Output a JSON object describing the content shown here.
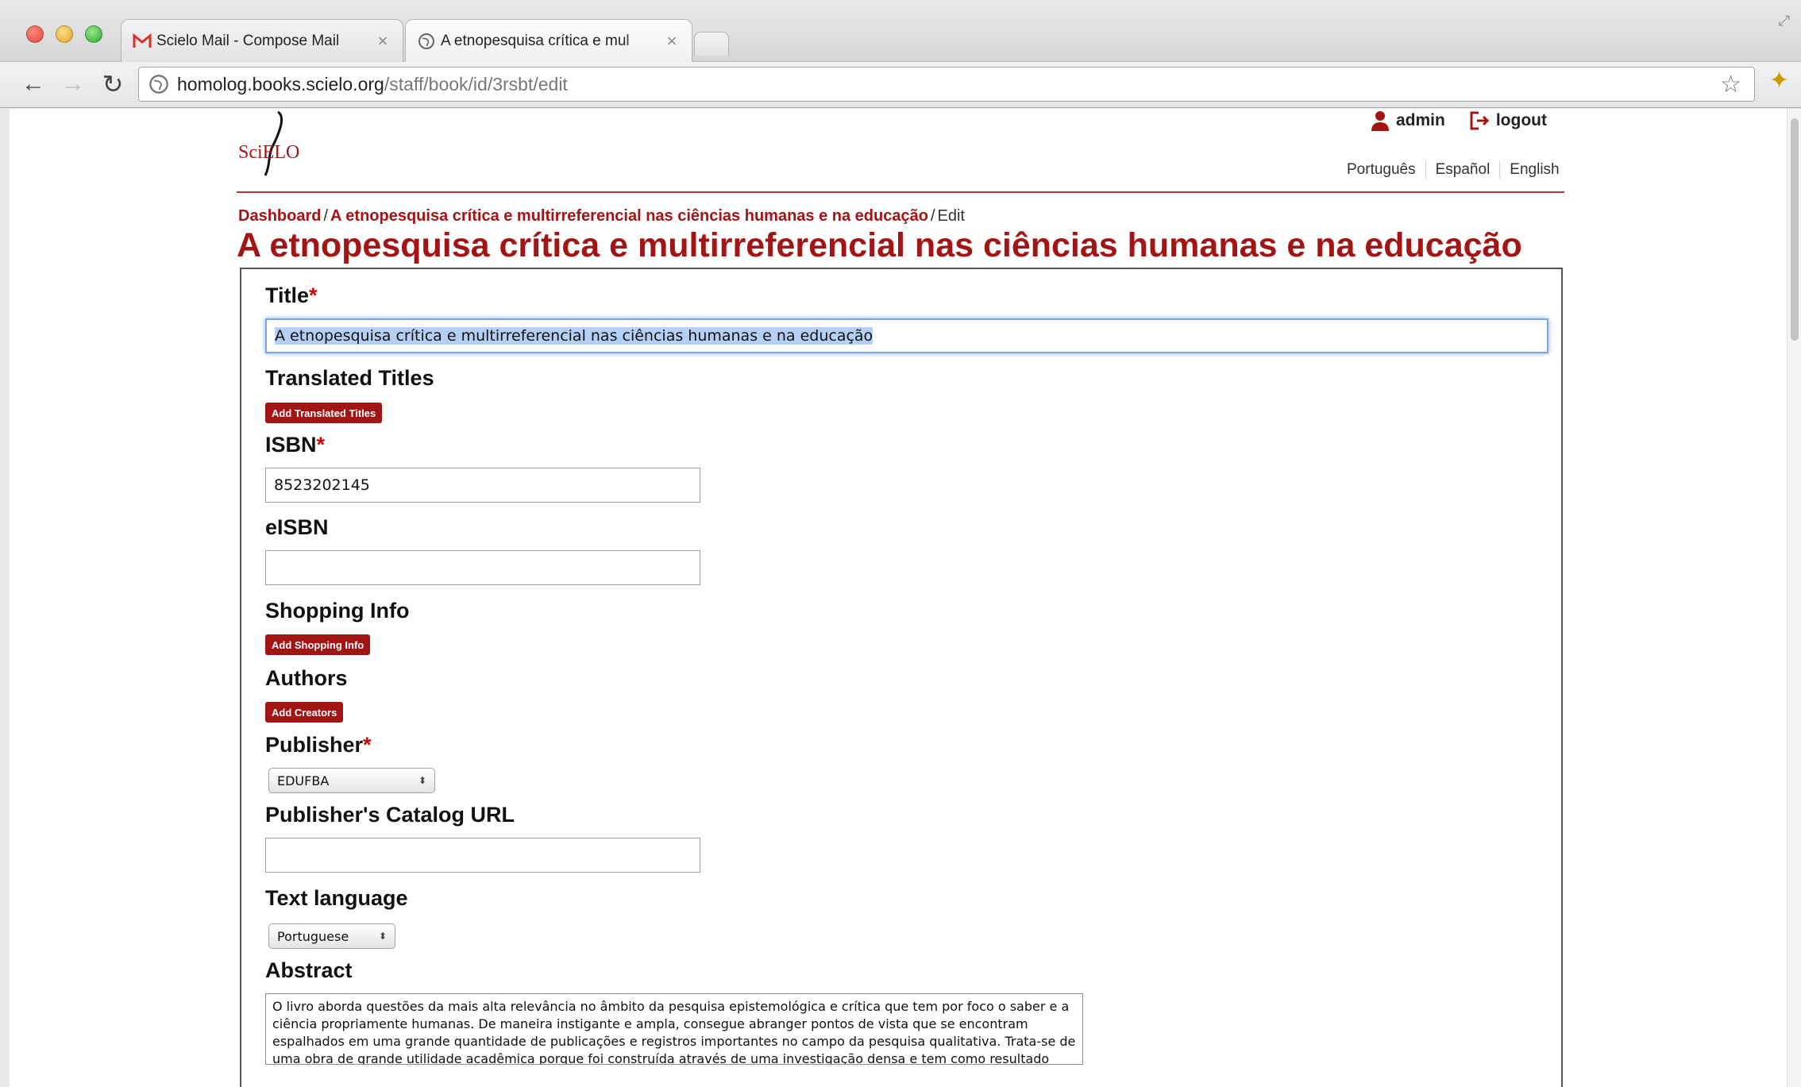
{
  "browser": {
    "tabs": [
      {
        "label": "Scielo Mail - Compose Mail",
        "favicon": "gmail-icon"
      },
      {
        "label": "A etnopesquisa crítica e mul",
        "favicon": "globe-icon"
      }
    ],
    "url_host": "homolog.books.scielo.org",
    "url_path": "/staff/book/id/3rsbt/edit"
  },
  "header": {
    "logo": "SciELO",
    "user": "admin",
    "logout": "logout",
    "languages": [
      "Português",
      "Español",
      "English"
    ]
  },
  "breadcrumb": {
    "dashboard": "Dashboard",
    "book": "A etnopesquisa crítica e multirreferencial nas ciências humanas e na educação",
    "current": "Edit",
    "sep": "/"
  },
  "page_title": "A etnopesquisa crítica e multirreferencial nas ciências humanas e na educação",
  "form": {
    "required_mark": "*",
    "title_label": "Title",
    "title_value": "A etnopesquisa crítica e multirreferencial nas ciências humanas e na educação",
    "translated_titles_label": "Translated Titles",
    "translated_titles_button": "Add Translated Titles",
    "isbn_label": "ISBN",
    "isbn_value": "8523202145",
    "eisbn_label": "eISBN",
    "eisbn_value": "",
    "shopping_label": "Shopping Info",
    "shopping_button": "Add Shopping Info",
    "authors_label": "Authors",
    "authors_button": "Add Creators",
    "publisher_label": "Publisher",
    "publisher_value": "EDUFBA",
    "catalog_url_label": "Publisher's Catalog URL",
    "catalog_url_value": "",
    "text_language_label": "Text language",
    "text_language_value": "Portuguese",
    "abstract_label": "Abstract",
    "abstract_value": "O livro aborda questões da mais alta relevância no âmbito da pesquisa epistemológica e crítica que tem por foco o saber e a ciência propriamente humanas. De maneira instigante e ampla, consegue abranger pontos de vista que se encontram espalhados em uma grande quantidade de publicações e registros importantes no campo da pesquisa qualitativa. Trata-se de uma obra de grande utilidade acadêmica porque foi construída através de uma investigação densa e tem como resultado sínteses conceituais."
  },
  "colors": {
    "brand": "#a31515",
    "focus": "#7aa7e0"
  }
}
